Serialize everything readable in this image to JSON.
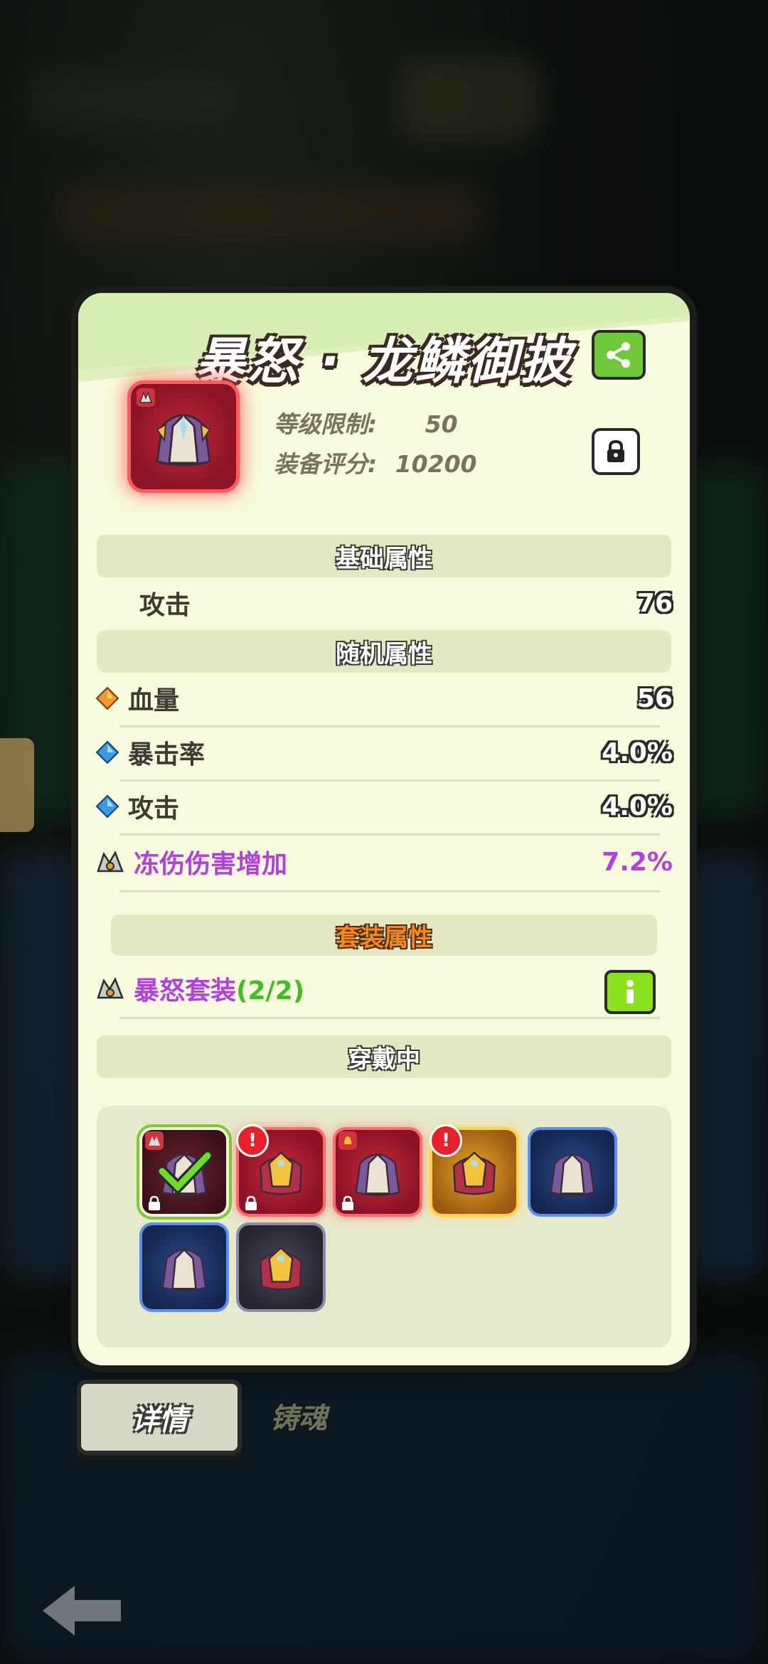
{
  "item": {
    "title": "暴怒 · 龙鳞御披",
    "level_label": "等级限制:",
    "level_value": "50",
    "score_label": "装备评分:",
    "score_value": "10200"
  },
  "sections": {
    "base": "基础属性",
    "random": "随机属性",
    "set": "套装属性",
    "wearing": "穿戴中"
  },
  "base_stats": [
    {
      "label": "攻击",
      "value": "76"
    }
  ],
  "random_stats": [
    {
      "label": "血量",
      "value": "56",
      "gem": "orange-diamond-icon"
    },
    {
      "label": "暴击率",
      "value": "4.0%",
      "gem": "blue-diamond-icon"
    },
    {
      "label": "攻击",
      "value": "4.0%",
      "gem": "blue-diamond-icon"
    },
    {
      "label": "冻伤伤害增加",
      "value": "7.2%",
      "gem": "set-emblem-icon"
    }
  ],
  "set_bonus": {
    "name": "暴怒套装",
    "count": "(2/2)"
  },
  "tabs": {
    "details": "详情",
    "forge": "铸魂"
  },
  "colors": {
    "rarity_red": "#c92a3e",
    "set_purple": "#b33fe0",
    "positive_green": "#3ec023",
    "panel_bg": "#f7fadc"
  }
}
